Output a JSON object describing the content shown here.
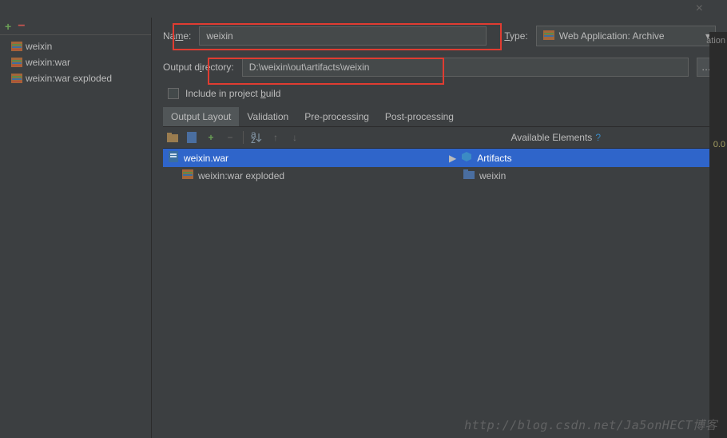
{
  "titlebar": {
    "close": "×"
  },
  "sidebar": {
    "plus": "+",
    "minus": "−",
    "items": [
      {
        "label": "weixin"
      },
      {
        "label": "weixin:war"
      },
      {
        "label": "weixin:war exploded"
      }
    ]
  },
  "form": {
    "name_label_pre": "Na",
    "name_label_u": "m",
    "name_label_post": "e:",
    "name_value": "weixin",
    "type_label_u": "T",
    "type_label_post": "ype:",
    "type_value": "Web Application: Archive",
    "dir_label_pre": "Output d",
    "dir_label_u": "i",
    "dir_label_post": "rectory:",
    "dir_value": "D:\\weixin\\out\\artifacts\\weixin",
    "browse": "…",
    "checkbox_pre": "Include in project ",
    "checkbox_u": "b",
    "checkbox_post": "uild"
  },
  "tabs": {
    "output_layout": "Output Layout",
    "validation": "Validation",
    "preprocessing": "Pre-processing",
    "postprocessing": "Post-processing"
  },
  "toolbar": {
    "available": "Available Elements",
    "help": "?"
  },
  "trees": {
    "left_root": "weixin.war",
    "left_child": "weixin:war exploded",
    "right_root": "Artifacts",
    "right_child": "weixin"
  },
  "edge": {
    "text": "ation",
    "num": "0.0"
  },
  "watermark": "http://blog.csdn.net/Ja5onHECT博客"
}
